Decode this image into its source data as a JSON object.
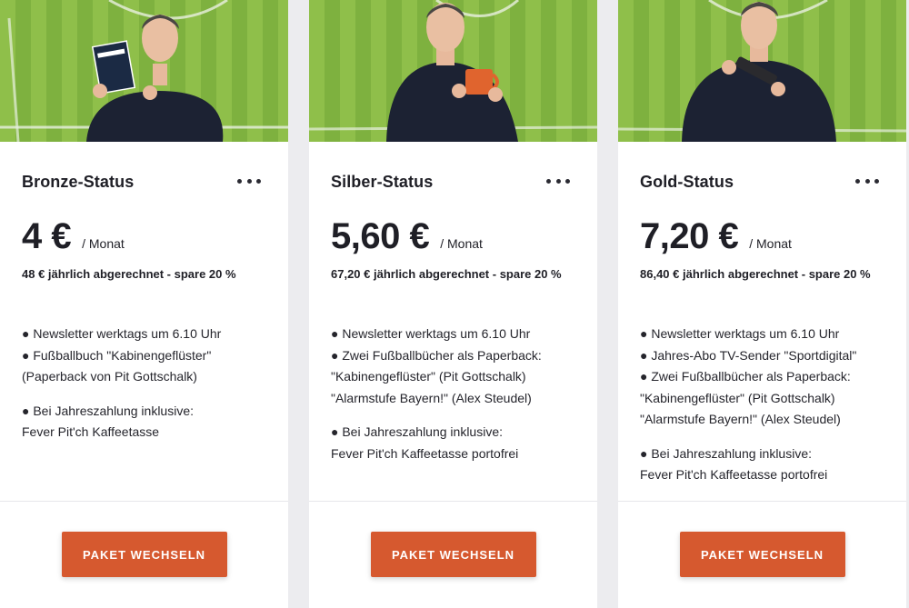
{
  "plans": [
    {
      "title": "Bronze-Status",
      "price": "4 €",
      "per": "/ Monat",
      "yearly": "48 € jährlich abgerechnet - spare 20 %",
      "features": [
        "● Newsletter werktags um 6.10 Uhr",
        "● Fußballbuch \"Kabinengeflüster\"",
        "(Paperback von Pit Gottschalk)"
      ],
      "bonus": [
        "● Bei Jahreszahlung inklusive:",
        "Fever Pit'ch Kaffeetasse"
      ],
      "button": "PAKET WECHSELN",
      "photo_item": "book",
      "item_text": "Kabinengeflüster"
    },
    {
      "title": "Silber-Status",
      "price": "5,60 €",
      "per": "/ Monat",
      "yearly": "67,20 € jährlich abgerechnet - spare 20 %",
      "features": [
        "● Newsletter werktags um 6.10 Uhr",
        "● Zwei Fußballbücher als Paperback:",
        "\"Kabinengeflüster\" (Pit Gottschalk)",
        "\"Alarmstufe Bayern!\" (Alex Steudel)"
      ],
      "bonus": [
        "● Bei Jahreszahlung inklusive:",
        "Fever Pit'ch Kaffeetasse portofrei"
      ],
      "button": "PAKET WECHSELN",
      "photo_item": "mug",
      "item_text": "Fever Pit'ch"
    },
    {
      "title": "Gold-Status",
      "price": "7,20 €",
      "per": "/ Monat",
      "yearly": "86,40 € jährlich abgerechnet - spare 20 %",
      "features": [
        "● Newsletter werktags um 6.10 Uhr",
        "● Jahres-Abo TV-Sender \"Sportdigital\"",
        "● Zwei Fußballbücher als Paperback:",
        "\"Kabinengeflüster\" (Pit Gottschalk)",
        "\"Alarmstufe Bayern!\" (Alex Steudel)"
      ],
      "bonus": [
        "● Bei Jahreszahlung inklusive:",
        "Fever Pit'ch Kaffeetasse portofrei"
      ],
      "button": "PAKET WECHSELN",
      "photo_item": "remote"
    }
  ],
  "colors": {
    "accent": "#d6592f",
    "grass_light": "#8fbf4a",
    "grass_dark": "#6fa233",
    "sweater": "#1c2233"
  }
}
